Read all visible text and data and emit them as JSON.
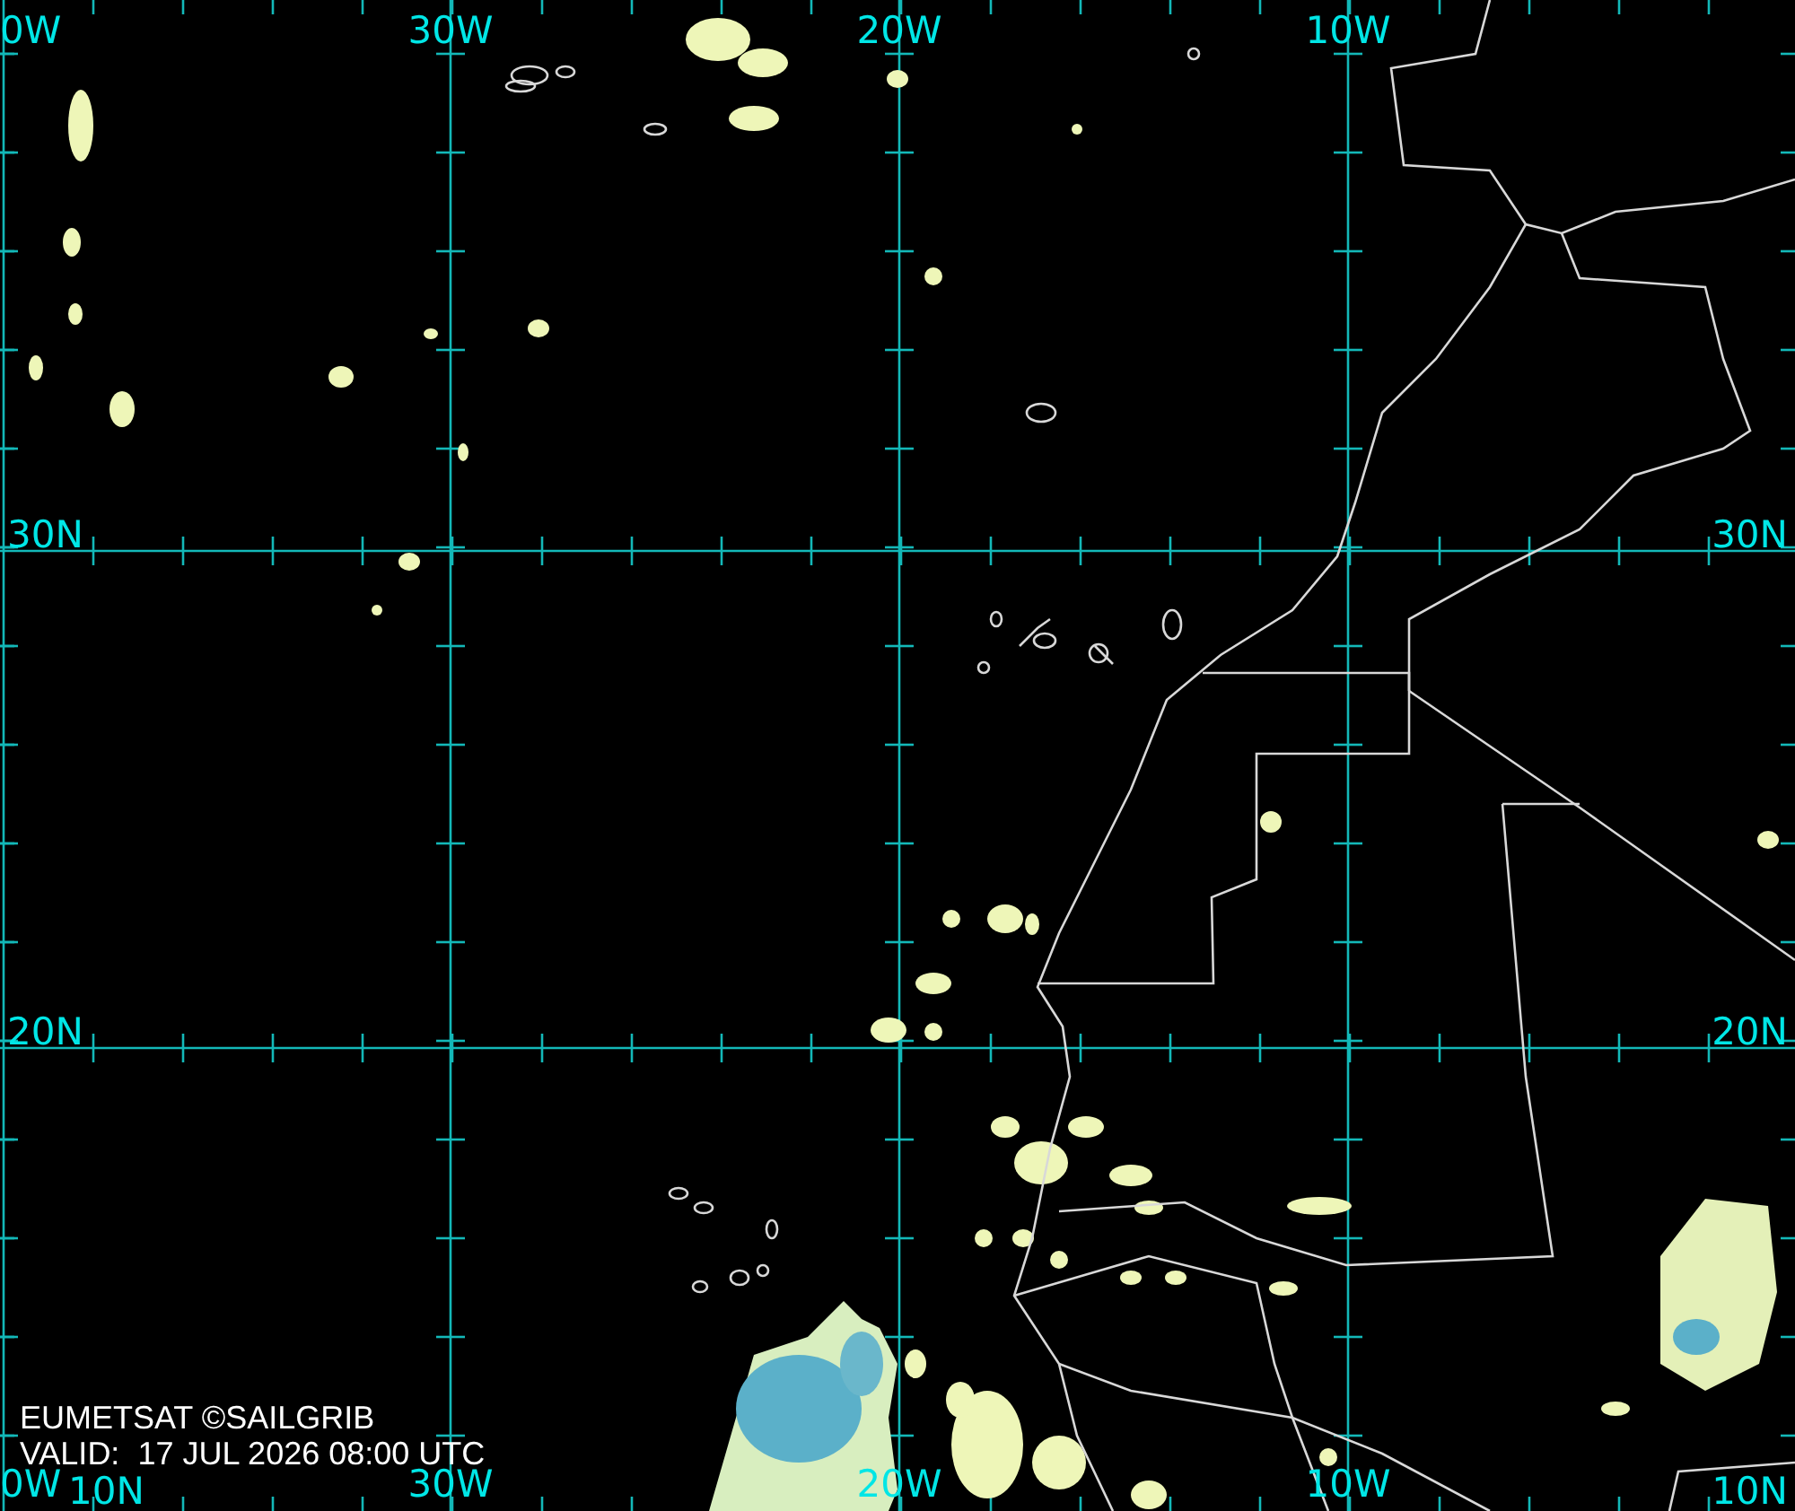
{
  "map": {
    "meridians": [
      {
        "label_top": "0W",
        "label_bottom": "0W"
      },
      {
        "label_top": "30W",
        "label_bottom": "30W"
      },
      {
        "label_top": "20W",
        "label_bottom": "20W"
      },
      {
        "label_top": "10W",
        "label_bottom": "10W"
      }
    ],
    "parallels": [
      {
        "label_left": "30N",
        "label_right": "30N"
      },
      {
        "label_left": "20N",
        "label_right": "20N"
      },
      {
        "label_left": "10N",
        "label_right": "10N"
      }
    ]
  },
  "credit": "EUMETSAT ©SAILGRIB",
  "valid": "VALID:  17 JUL 2026 08:00 UTC"
}
